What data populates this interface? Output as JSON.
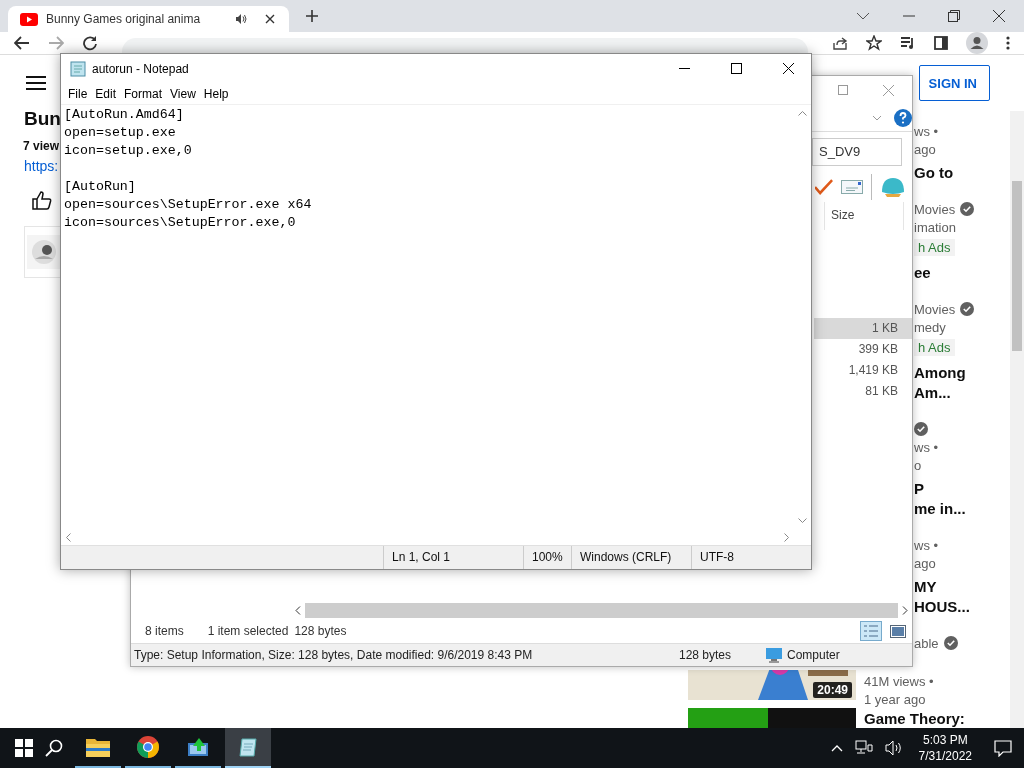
{
  "browser": {
    "tab": {
      "title": "Bunny Games original anima",
      "audio": true
    }
  },
  "youtube": {
    "sign_in": "SIGN IN",
    "video_title": "Bun",
    "views": "7 view",
    "link": "https:",
    "recommendations": [
      {
        "kind": "partial",
        "lines": [
          {
            "kind": "meta",
            "text": "ws •"
          },
          {
            "kind": "meta",
            "text": "ago"
          }
        ]
      },
      {
        "kind": "partial",
        "lines": [
          {
            "kind": "title",
            "text": "Go to"
          },
          {
            "kind": "meta",
            "text": "Movies",
            "verified": true
          },
          {
            "kind": "meta",
            "text": "imation"
          },
          {
            "kind": "badge",
            "text": "h Ads"
          }
        ]
      },
      {
        "kind": "partial",
        "lines": [
          {
            "kind": "title",
            "text": "ee"
          },
          {
            "kind": "meta",
            "text": "Movies",
            "verified": true
          },
          {
            "kind": "meta",
            "text": "medy"
          },
          {
            "kind": "badge",
            "text": "h Ads"
          }
        ]
      },
      {
        "kind": "partial",
        "lines": [
          {
            "kind": "title",
            "text": "Among"
          },
          {
            "kind": "title",
            "text": "Am..."
          },
          {
            "kind": "meta",
            "verified": true
          },
          {
            "kind": "meta",
            "text": "ws •"
          },
          {
            "kind": "meta",
            "text": "o"
          }
        ]
      },
      {
        "kind": "partial",
        "lines": [
          {
            "kind": "title",
            "text": "P"
          },
          {
            "kind": "title",
            "text": "me in..."
          },
          {
            "kind": "meta",
            "text": "ws •"
          },
          {
            "kind": "meta",
            "text": "ago"
          }
        ]
      },
      {
        "kind": "partial",
        "lines": [
          {
            "kind": "title",
            "text": "MY"
          },
          {
            "kind": "title",
            "text": "HOUS..."
          },
          {
            "kind": "meta",
            "text": "able",
            "verified": true
          }
        ]
      },
      {
        "kind": "full",
        "duration": "20:49",
        "lines": [
          {
            "kind": "meta",
            "text": "41M views •"
          },
          {
            "kind": "meta",
            "text": "1 year ago"
          }
        ]
      },
      {
        "kind": "full",
        "lines": [
          {
            "kind": "title",
            "text": "Game Theory:"
          }
        ]
      }
    ]
  },
  "explorer": {
    "search_value": "S_DV9",
    "column": "Size",
    "files": [
      {
        "size": "1 KB",
        "selected": true
      },
      {
        "size": "399 KB",
        "selected": false
      },
      {
        "size": "1,419 KB",
        "selected": false
      },
      {
        "size": "81 KB",
        "selected": false
      }
    ],
    "status": {
      "count": "8 items",
      "selection": "1 item selected",
      "selection_size": "128 bytes"
    },
    "details": {
      "info": "Type: Setup Information, Size: 128 bytes, Date modified: 9/6/2019 8:43 PM",
      "size": "128 bytes",
      "location": "Computer"
    }
  },
  "notepad": {
    "title": "autorun - Notepad",
    "menu": [
      "File",
      "Edit",
      "Format",
      "View",
      "Help"
    ],
    "sections": [
      [
        "[AutoRun.Amd64]",
        "open=setup.exe",
        "icon=setup.exe,0"
      ],
      [
        "[AutoRun]",
        "open=sources\\SetupError.exe x64",
        "icon=sources\\SetupError.exe,0"
      ]
    ],
    "status": {
      "position": "Ln 1, Col 1",
      "zoom": "100%",
      "line_ending": "Windows (CRLF)",
      "encoding": "UTF-8"
    }
  },
  "taskbar": {
    "apps": [
      {
        "kind": "explorer",
        "active": false
      },
      {
        "kind": "chrome",
        "active": false
      },
      {
        "kind": "installer",
        "active": false
      },
      {
        "kind": "notepad",
        "active": true
      }
    ],
    "time": "5:03 PM",
    "date": "7/31/2022"
  }
}
